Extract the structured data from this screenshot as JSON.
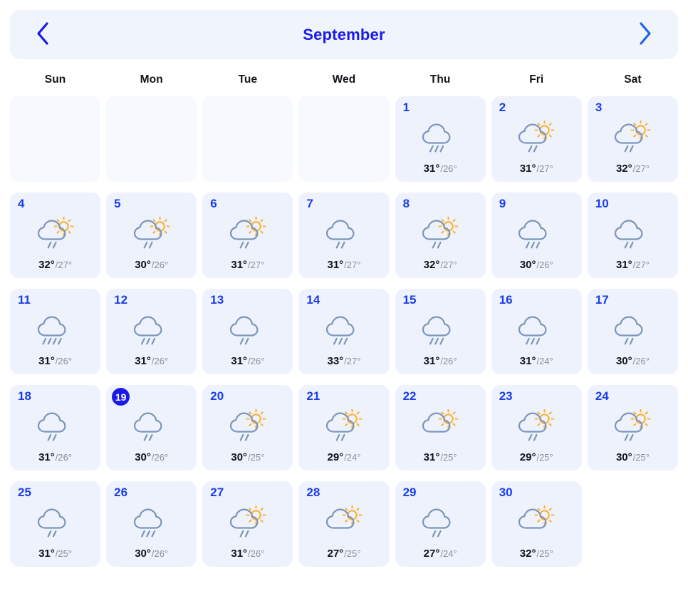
{
  "header": {
    "title": "September",
    "prev_icon": "chevron-left-icon",
    "next_icon": "chevron-right-icon",
    "prev_label": "Previous month",
    "next_label": "Next month",
    "bg_color": "#eff4fd",
    "title_color": "#1a1ae8",
    "prev_color": "#1a1ae8",
    "next_color": "#2563eb"
  },
  "weekdays": [
    "Sun",
    "Mon",
    "Tue",
    "Wed",
    "Thu",
    "Fri",
    "Sat"
  ],
  "colors": {
    "cell_bg": "#eef2fd",
    "empty_cell_bg": "#f7f9fe",
    "day_number": "#1a3de8",
    "today_badge_bg": "#1a1ae8",
    "today_badge_text": "#ffffff",
    "high_temp": "#111318",
    "low_temp": "#8b8f99",
    "cloud_stroke": "#7d95b8",
    "rain_stroke": "#7d95b8",
    "sun_color": "#f9b233"
  },
  "leading_blanks": 4,
  "days": [
    {
      "day": "1",
      "weekday": "Thu",
      "icon": "cloud-rain-icon",
      "rain_drops": 3,
      "sun": false,
      "high": "31°",
      "low": "/26°",
      "today": false
    },
    {
      "day": "2",
      "weekday": "Fri",
      "icon": "cloud-sun-rain-icon",
      "rain_drops": 2,
      "sun": true,
      "high": "31°",
      "low": "/27°",
      "today": false
    },
    {
      "day": "3",
      "weekday": "Sat",
      "icon": "cloud-sun-rain-icon",
      "rain_drops": 2,
      "sun": true,
      "high": "32°",
      "low": "/27°",
      "today": false
    },
    {
      "day": "4",
      "weekday": "Sun",
      "icon": "cloud-sun-rain-icon",
      "rain_drops": 2,
      "sun": true,
      "high": "32°",
      "low": "/27°",
      "today": false
    },
    {
      "day": "5",
      "weekday": "Mon",
      "icon": "cloud-sun-rain-icon",
      "rain_drops": 2,
      "sun": true,
      "high": "30°",
      "low": "/26°",
      "today": false
    },
    {
      "day": "6",
      "weekday": "Tue",
      "icon": "cloud-sun-rain-icon",
      "rain_drops": 2,
      "sun": true,
      "high": "31°",
      "low": "/27°",
      "today": false
    },
    {
      "day": "7",
      "weekday": "Wed",
      "icon": "cloud-rain-icon",
      "rain_drops": 2,
      "sun": false,
      "high": "31°",
      "low": "/27°",
      "today": false
    },
    {
      "day": "8",
      "weekday": "Thu",
      "icon": "cloud-sun-rain-icon",
      "rain_drops": 2,
      "sun": true,
      "high": "32°",
      "low": "/27°",
      "today": false
    },
    {
      "day": "9",
      "weekday": "Fri",
      "icon": "cloud-rain-icon",
      "rain_drops": 3,
      "sun": false,
      "high": "30°",
      "low": "/26°",
      "today": false
    },
    {
      "day": "10",
      "weekday": "Sat",
      "icon": "cloud-rain-icon",
      "rain_drops": 2,
      "sun": false,
      "high": "31°",
      "low": "/27°",
      "today": false
    },
    {
      "day": "11",
      "weekday": "Sun",
      "icon": "cloud-rain-heavy-icon",
      "rain_drops": 4,
      "sun": false,
      "high": "31°",
      "low": "/26°",
      "today": false
    },
    {
      "day": "12",
      "weekday": "Mon",
      "icon": "cloud-rain-icon",
      "rain_drops": 3,
      "sun": false,
      "high": "31°",
      "low": "/26°",
      "today": false
    },
    {
      "day": "13",
      "weekday": "Tue",
      "icon": "cloud-rain-icon",
      "rain_drops": 2,
      "sun": false,
      "high": "31°",
      "low": "/26°",
      "today": false
    },
    {
      "day": "14",
      "weekday": "Wed",
      "icon": "cloud-rain-icon",
      "rain_drops": 3,
      "sun": false,
      "high": "33°",
      "low": "/27°",
      "today": false
    },
    {
      "day": "15",
      "weekday": "Thu",
      "icon": "cloud-rain-icon",
      "rain_drops": 3,
      "sun": false,
      "high": "31°",
      "low": "/26°",
      "today": false
    },
    {
      "day": "16",
      "weekday": "Fri",
      "icon": "cloud-rain-icon",
      "rain_drops": 3,
      "sun": false,
      "high": "31°",
      "low": "/24°",
      "today": false
    },
    {
      "day": "17",
      "weekday": "Sat",
      "icon": "cloud-rain-icon",
      "rain_drops": 2,
      "sun": false,
      "high": "30°",
      "low": "/26°",
      "today": false
    },
    {
      "day": "18",
      "weekday": "Sun",
      "icon": "cloud-rain-icon",
      "rain_drops": 2,
      "sun": false,
      "high": "31°",
      "low": "/26°",
      "today": false
    },
    {
      "day": "19",
      "weekday": "Mon",
      "icon": "cloud-rain-icon",
      "rain_drops": 2,
      "sun": false,
      "high": "30°",
      "low": "/26°",
      "today": true
    },
    {
      "day": "20",
      "weekday": "Tue",
      "icon": "cloud-sun-rain-icon",
      "rain_drops": 2,
      "sun": true,
      "high": "30°",
      "low": "/25°",
      "today": false
    },
    {
      "day": "21",
      "weekday": "Wed",
      "icon": "cloud-sun-rain-icon",
      "rain_drops": 2,
      "sun": true,
      "high": "29°",
      "low": "/24°",
      "today": false
    },
    {
      "day": "22",
      "weekday": "Thu",
      "icon": "cloud-sun-icon",
      "rain_drops": 0,
      "sun": true,
      "high": "31°",
      "low": "/25°",
      "today": false
    },
    {
      "day": "23",
      "weekday": "Fri",
      "icon": "cloud-sun-rain-icon",
      "rain_drops": 2,
      "sun": true,
      "high": "29°",
      "low": "/25°",
      "today": false
    },
    {
      "day": "24",
      "weekday": "Sat",
      "icon": "cloud-sun-rain-icon",
      "rain_drops": 2,
      "sun": true,
      "high": "30°",
      "low": "/25°",
      "today": false
    },
    {
      "day": "25",
      "weekday": "Sun",
      "icon": "cloud-rain-icon",
      "rain_drops": 2,
      "sun": false,
      "high": "31°",
      "low": "/25°",
      "today": false
    },
    {
      "day": "26",
      "weekday": "Mon",
      "icon": "cloud-rain-icon",
      "rain_drops": 3,
      "sun": false,
      "high": "30°",
      "low": "/26°",
      "today": false
    },
    {
      "day": "27",
      "weekday": "Tue",
      "icon": "cloud-sun-rain-icon",
      "rain_drops": 2,
      "sun": true,
      "high": "31°",
      "low": "/26°",
      "today": false
    },
    {
      "day": "28",
      "weekday": "Wed",
      "icon": "cloud-sun-icon",
      "rain_drops": 0,
      "sun": true,
      "high": "27°",
      "low": "/25°",
      "today": false
    },
    {
      "day": "29",
      "weekday": "Thu",
      "icon": "cloud-rain-icon",
      "rain_drops": 2,
      "sun": false,
      "high": "27°",
      "low": "/24°",
      "today": false
    },
    {
      "day": "30",
      "weekday": "Fri",
      "icon": "cloud-sun-icon",
      "rain_drops": 0,
      "sun": true,
      "high": "32°",
      "low": "/25°",
      "today": false
    }
  ],
  "trailing_blanks": 1
}
